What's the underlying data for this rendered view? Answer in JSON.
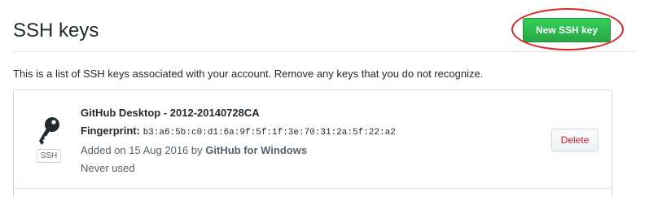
{
  "header": {
    "title": "SSH keys",
    "new_button_label": "New SSH key"
  },
  "intro_text": "This is a list of SSH keys associated with your account. Remove any keys that you do not recognize.",
  "keys": [
    {
      "title": "GitHub Desktop - 2012-20140728CA",
      "fingerprint_label": "Fingerprint:",
      "fingerprint": "b3:a6:5b:c0:d1:6a:9f:5f:1f:3e:70:31:2a:5f:22:a2",
      "added_prefix": "Added on 15 Aug 2016 by",
      "added_by": "GitHub for Windows",
      "last_used": "Never used",
      "badge": "SSH",
      "delete_label": "Delete"
    }
  ],
  "colors": {
    "primary_green": "#28a745",
    "danger_red": "#cb2431",
    "annotation_red": "#e02424"
  },
  "icons": {
    "key": "key-icon"
  }
}
